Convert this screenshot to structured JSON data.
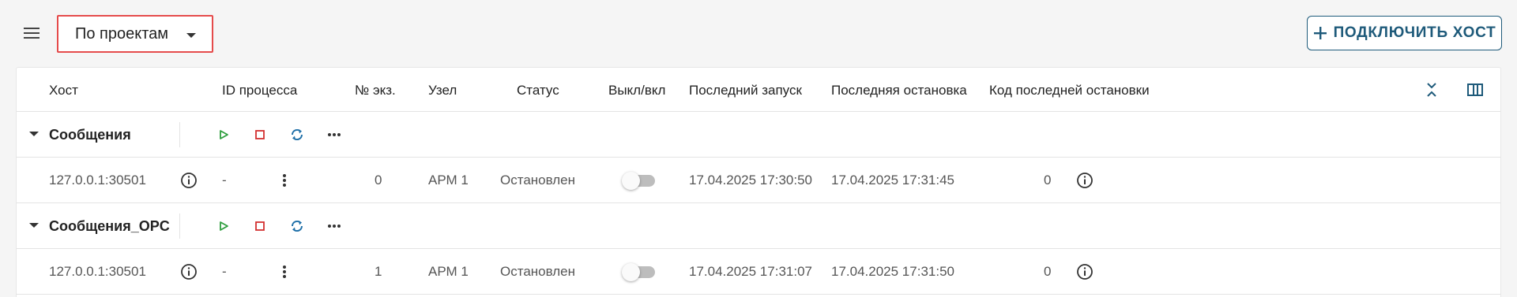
{
  "toolbar": {
    "grouping_value": "По проектам",
    "connect_button_label": "ПОДКЛЮЧИТЬ ХОСТ"
  },
  "table": {
    "columns": {
      "host": "Хост",
      "process_id": "ID процесса",
      "instance_no": "№ экз.",
      "node": "Узел",
      "status": "Статус",
      "toggle": "Выкл/вкл",
      "last_start": "Последний запуск",
      "last_stop": "Последняя остановка",
      "last_stop_code": "Код последней остановки"
    },
    "groups": [
      {
        "name": "Сообщения",
        "rows": [
          {
            "host": "127.0.0.1:30501",
            "process_id": "-",
            "instance_no": "0",
            "node": "АРМ 1",
            "status": "Остановлен",
            "enabled": false,
            "last_start": "17.04.2025 17:30:50",
            "last_stop": "17.04.2025 17:31:45",
            "last_stop_code": "0"
          }
        ]
      },
      {
        "name": "Сообщения_OPC",
        "rows": [
          {
            "host": "127.0.0.1:30501",
            "process_id": "-",
            "instance_no": "1",
            "node": "АРМ 1",
            "status": "Остановлен",
            "enabled": false,
            "last_start": "17.04.2025 17:31:07",
            "last_stop": "17.04.2025 17:31:50",
            "last_stop_code": "0"
          }
        ]
      }
    ]
  },
  "colors": {
    "accent": "#1e5a7a",
    "highlight_border": "#e54b4b",
    "play_green": "#2e9e3e",
    "stop_red": "#d32f2f",
    "restart_blue": "#1e6fa8"
  },
  "icons": {
    "menu": "hamburger-icon",
    "dropdown": "caret-down-icon",
    "add": "plus-icon",
    "collapse": "collapse-all-icon",
    "columns": "columns-icon",
    "expand": "chevron-down-icon",
    "play": "play-icon",
    "stop": "stop-icon",
    "restart": "restart-icon",
    "more": "more-horizontal-icon",
    "info": "info-icon",
    "row_menu": "more-vertical-icon"
  }
}
